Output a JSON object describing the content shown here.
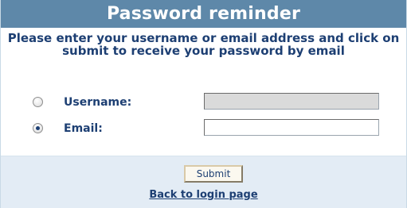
{
  "header": {
    "title": "Password reminder"
  },
  "instructions": {
    "text": "Please enter your username or email address and click on submit to receive your password by email"
  },
  "form": {
    "username": {
      "label": "Username:",
      "selected": false,
      "value": ""
    },
    "email": {
      "label": "Email:",
      "selected": true,
      "value": ""
    }
  },
  "footer": {
    "submit_label": "Submit",
    "back_link": "Back to login page"
  },
  "colors": {
    "header_bg": "#5e88a9",
    "text": "#1d3f73",
    "footer_bg": "#e3ecf5"
  },
  "icons": {
    "username_radio": "radio-unchecked-icon",
    "email_radio": "radio-checked-icon"
  }
}
